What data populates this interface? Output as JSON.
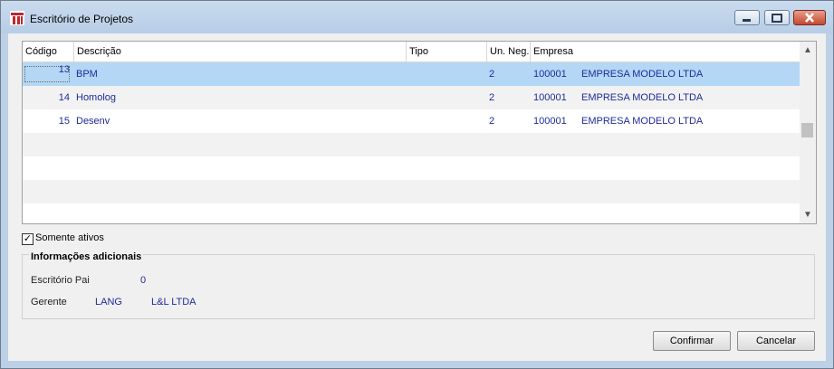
{
  "window": {
    "title": "Escritório de Projetos"
  },
  "grid": {
    "columns": [
      "Código",
      "Descrição",
      "Tipo",
      "Un. Neg.",
      "Empresa"
    ],
    "rows": [
      {
        "codigo": "13",
        "descricao": "BPM",
        "tipo": "",
        "un_neg": "2",
        "empresa_codigo": "100001",
        "empresa_nome": "EMPRESA MODELO LTDA",
        "selected": true
      },
      {
        "codigo": "14",
        "descricao": "Homolog",
        "tipo": "",
        "un_neg": "2",
        "empresa_codigo": "100001",
        "empresa_nome": "EMPRESA MODELO LTDA",
        "selected": false
      },
      {
        "codigo": "15",
        "descricao": "Desenv",
        "tipo": "",
        "un_neg": "2",
        "empresa_codigo": "100001",
        "empresa_nome": "EMPRESA MODELO LTDA",
        "selected": false
      }
    ]
  },
  "filter": {
    "label": "Somente ativos",
    "checked": true
  },
  "info": {
    "title": "Informações adicionais",
    "escritorio_pai_label": "Escritório Pai",
    "escritorio_pai_value": "0",
    "gerente_label": "Gerente",
    "gerente_code": "LANG",
    "gerente_name": "L&L LTDA"
  },
  "buttons": {
    "confirm": "Confirmar",
    "cancel": "Cancelar"
  },
  "colors": {
    "selection": "#b3d7f5",
    "value_text": "#1f2b99",
    "title_bar": "#bcd0e6"
  }
}
